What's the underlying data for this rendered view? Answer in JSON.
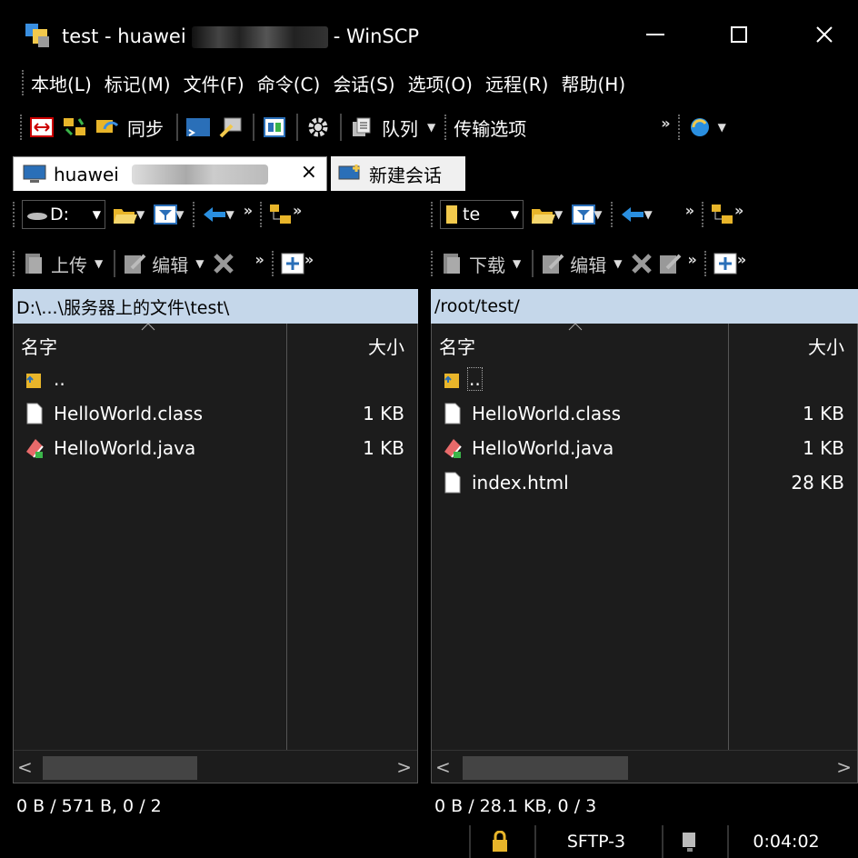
{
  "window": {
    "title_prefix": "test - huawei",
    "title_suffix": "- WinSCP"
  },
  "menu": [
    "本地(L)",
    "标记(M)",
    "文件(F)",
    "命令(C)",
    "会话(S)",
    "选项(O)",
    "远程(R)",
    "帮助(H)"
  ],
  "toolbar": {
    "sync_label": "同步",
    "queue_label": "队列",
    "transfer_options_label": "传输选项"
  },
  "tabs": {
    "active_label": "huawei",
    "close_symbol": "×",
    "new_session_label": "新建会话"
  },
  "left_panel": {
    "drive_label": "D:",
    "upload_label": "上传",
    "edit_label": "编辑",
    "path": "D:\\...\\服务器上的文件\\test\\",
    "col_name": "名字",
    "col_size": "大小",
    "files": [
      {
        "name": "..",
        "size": "",
        "icon": "parent-folder-icon"
      },
      {
        "name": "HelloWorld.class",
        "size": "1 KB",
        "icon": "file-icon"
      },
      {
        "name": "HelloWorld.java",
        "size": "1 KB",
        "icon": "java-file-icon"
      }
    ],
    "status": "0 B / 571 B,   0 / 2"
  },
  "right_panel": {
    "dir_label": "te",
    "download_label": "下载",
    "edit_label": "编辑",
    "path": "/root/test/",
    "col_name": "名字",
    "col_size": "大小",
    "files": [
      {
        "name": "..",
        "size": "",
        "icon": "parent-folder-icon"
      },
      {
        "name": "HelloWorld.class",
        "size": "1 KB",
        "icon": "file-icon"
      },
      {
        "name": "HelloWorld.java",
        "size": "1 KB",
        "icon": "java-file-icon"
      },
      {
        "name": "index.html",
        "size": "28 KB",
        "icon": "file-icon"
      }
    ],
    "status": "0 B / 28.1 KB,   0 / 3"
  },
  "statusbar": {
    "protocol": "SFTP-3",
    "elapsed": "0:04:02"
  },
  "colors": {
    "path_bar": "#c5d7ea",
    "panel_bg": "#1c1c1c",
    "background": "#000000"
  }
}
